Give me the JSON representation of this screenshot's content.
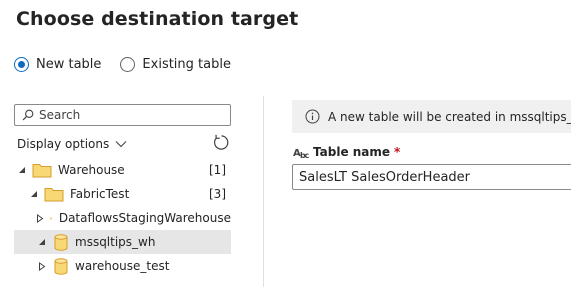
{
  "dialog": {
    "title": "Choose destination target"
  },
  "target_mode": {
    "options": [
      {
        "label": "New table",
        "selected": true
      },
      {
        "label": "Existing table",
        "selected": false
      }
    ]
  },
  "search": {
    "placeholder": "Search",
    "value": ""
  },
  "display_options": {
    "label": "Display options"
  },
  "tree": [
    {
      "label": "Warehouse",
      "count": "[1]",
      "expanded": true,
      "type": "folder"
    },
    {
      "label": "FabricTest",
      "count": "[3]",
      "expanded": true,
      "type": "folder"
    },
    {
      "label": "DataflowsStagingWarehouse",
      "expanded": false,
      "type": "database"
    },
    {
      "label": "mssqltips_wh",
      "expanded": true,
      "type": "database",
      "selected": true
    },
    {
      "label": "warehouse_test",
      "expanded": false,
      "type": "database"
    }
  ],
  "info": {
    "message": "A new table will be created in mssqltips_wh"
  },
  "table_name": {
    "label": "Table name",
    "required_marker": "*",
    "value": "SalesLT SalesOrderHeader"
  },
  "colors": {
    "accent": "#0f6cbd",
    "folder": "#f8d775",
    "folder_outline": "#d69e2e",
    "selected_row": "#e6e6e6",
    "required": "#c50f1f"
  }
}
